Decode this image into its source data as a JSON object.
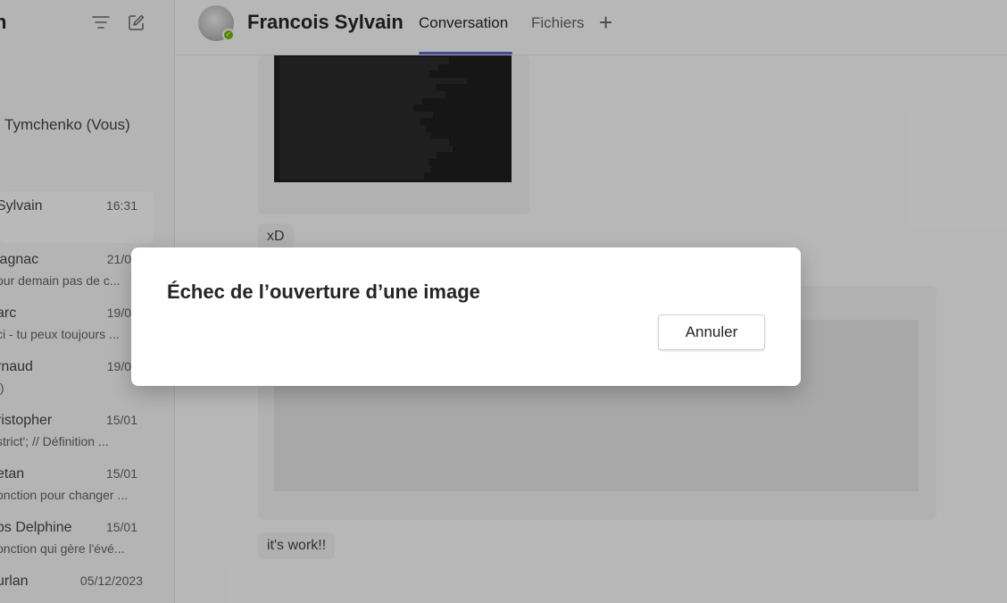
{
  "sidebar": {
    "title": "n",
    "self_item": "Tymchenko (Vous)",
    "chats": [
      {
        "name": "Sylvain",
        "time": "16:31",
        "preview": ""
      },
      {
        "name": "lagnac",
        "time": "21/0",
        "preview": "our demain pas de c..."
      },
      {
        "name": "arc",
        "time": "19/0",
        "preview": "ci - tu peux toujours ..."
      },
      {
        "name": "rnaud",
        "time": "19/0",
        "preview": ":)"
      },
      {
        "name": "ristopher",
        "time": "15/01",
        "preview": "strict';  // Définition ..."
      },
      {
        "name": "etan",
        "time": "15/01",
        "preview": "onction pour changer ..."
      },
      {
        "name": "ps Delphine",
        "time": "15/01",
        "preview": "onction qui gère l'évé..."
      },
      {
        "name": "urlan",
        "time": "05/12/2023",
        "preview": ""
      }
    ]
  },
  "header": {
    "contact_name": "Francois Sylvain",
    "tabs": [
      {
        "label": "Conversation",
        "active": true
      },
      {
        "label": "Fichiers",
        "active": false
      }
    ],
    "add_tab_symbol": "+",
    "status": "available"
  },
  "conversation": {
    "messages": [
      {
        "text": "xD"
      },
      {
        "text": "it's work!!"
      }
    ]
  },
  "dialog": {
    "title": "Échec de l’ouverture d’une image",
    "cancel_label": "Annuler"
  },
  "colors": {
    "accent": "#5b5fc7",
    "presence": "#6bb700"
  }
}
